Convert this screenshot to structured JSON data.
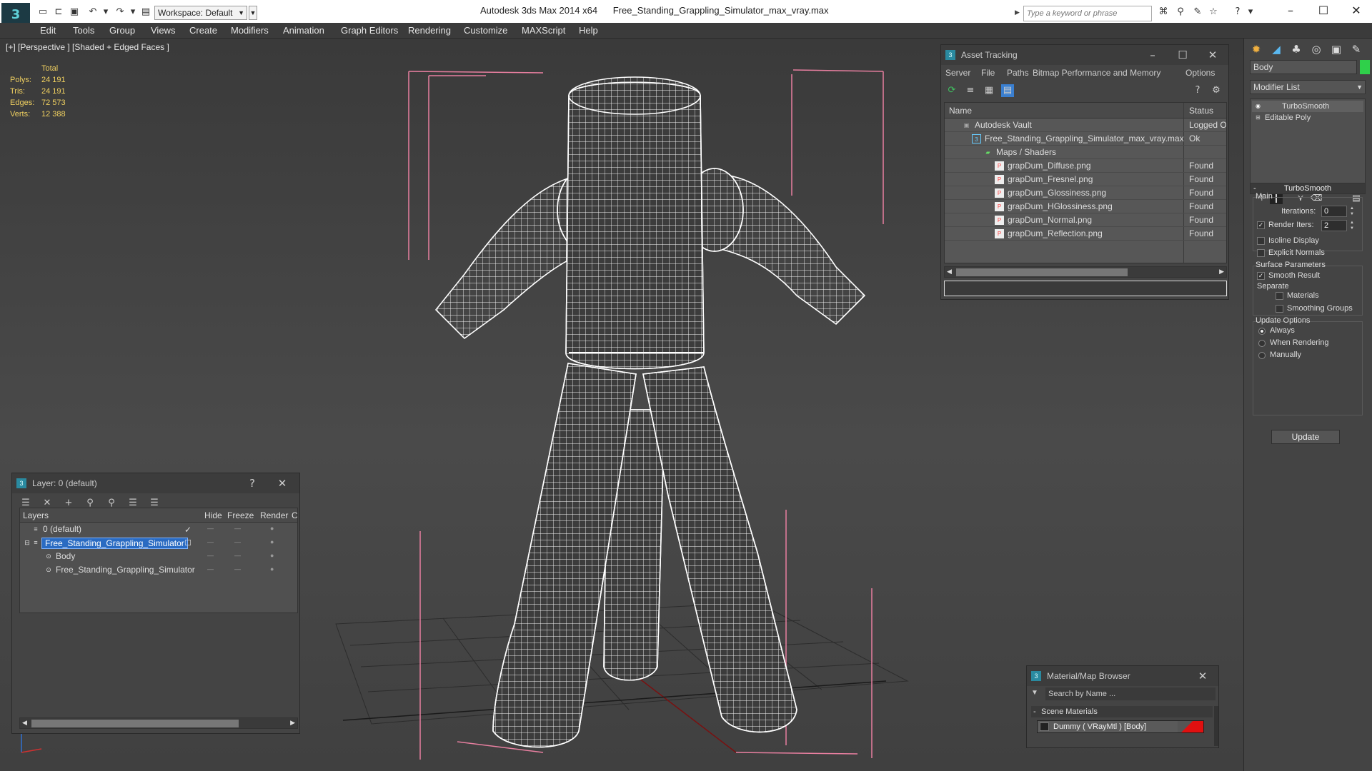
{
  "titlebar": {
    "app_name": "Autodesk 3ds Max  2014 x64",
    "file_name": "Free_Standing_Grappling_Simulator_max_vray.max",
    "workspace": "Workspace: Default",
    "search_placeholder": "Type a keyword or phrase"
  },
  "menu": [
    "Edit",
    "Tools",
    "Group",
    "Views",
    "Create",
    "Modifiers",
    "Animation",
    "Graph Editors",
    "Rendering",
    "Customize",
    "MAXScript",
    "Help"
  ],
  "viewport": {
    "label": "[+] [Perspective ] [Shaded + Edged Faces ]",
    "stats": {
      "header": "Total",
      "rows": [
        {
          "label": "Polys:",
          "value": "24 191"
        },
        {
          "label": "Tris:",
          "value": "24 191"
        },
        {
          "label": "Edges:",
          "value": "72 573"
        },
        {
          "label": "Verts:",
          "value": "12 388"
        }
      ]
    }
  },
  "asset_tracking": {
    "title": "Asset Tracking",
    "menu": [
      "Server",
      "File",
      "Paths",
      "Bitmap Performance and Memory",
      "Options"
    ],
    "columns": {
      "name": "Name",
      "status": "Status"
    },
    "rows": [
      {
        "name": "Autodesk Vault",
        "status": "Logged Out",
        "icon": "vault-icon"
      },
      {
        "name": "Free_Standing_Grappling_Simulator_max_vray.max",
        "status": "Ok",
        "icon": "max-file-icon"
      },
      {
        "name": "Maps / Shaders",
        "status": "",
        "icon": "maps-icon"
      },
      {
        "name": "grapDum_Diffuse.png",
        "status": "Found",
        "icon": "png-icon"
      },
      {
        "name": "grapDum_Fresnel.png",
        "status": "Found",
        "icon": "png-icon"
      },
      {
        "name": "grapDum_Glossiness.png",
        "status": "Found",
        "icon": "png-icon"
      },
      {
        "name": "grapDum_HGlossiness.png",
        "status": "Found",
        "icon": "png-icon"
      },
      {
        "name": "grapDum_Normal.png",
        "status": "Found",
        "icon": "png-icon"
      },
      {
        "name": "grapDum_Reflection.png",
        "status": "Found",
        "icon": "png-icon"
      }
    ]
  },
  "command_panel": {
    "object_name": "Body",
    "object_color": "#2fd04a",
    "modifier_list": "Modifier List",
    "stack": [
      "TurboSmooth",
      "Editable Poly"
    ],
    "turbosmooth": {
      "title": "TurboSmooth",
      "main_label": "Main",
      "iterations_label": "Iterations:",
      "iterations": "0",
      "render_iters_label": "Render Iters:",
      "render_iters": "2",
      "isoline": "Isoline Display",
      "explicit_normals": "Explicit Normals",
      "surface_params": "Surface Parameters",
      "smooth_result": "Smooth Result",
      "separate": "Separate",
      "materials": "Materials",
      "smoothing_groups": "Smoothing Groups",
      "update_options": "Update Options",
      "always": "Always",
      "when_rendering": "When Rendering",
      "manually": "Manually",
      "update": "Update"
    }
  },
  "layer_panel": {
    "title": "Layer: 0 (default)",
    "columns": {
      "layers": "Layers",
      "hide": "Hide",
      "freeze": "Freeze",
      "render": "Render",
      "c": "C"
    },
    "rows": [
      {
        "name": "0 (default)"
      },
      {
        "name": "Free_Standing_Grappling_Simulator"
      },
      {
        "name": "Body"
      },
      {
        "name": "Free_Standing_Grappling_Simulator"
      }
    ]
  },
  "material_browser": {
    "title": "Material/Map Browser",
    "search": "Search by Name ...",
    "section": "Scene Materials",
    "item": "Dummy  ( VRayMtl ) [Body]"
  }
}
